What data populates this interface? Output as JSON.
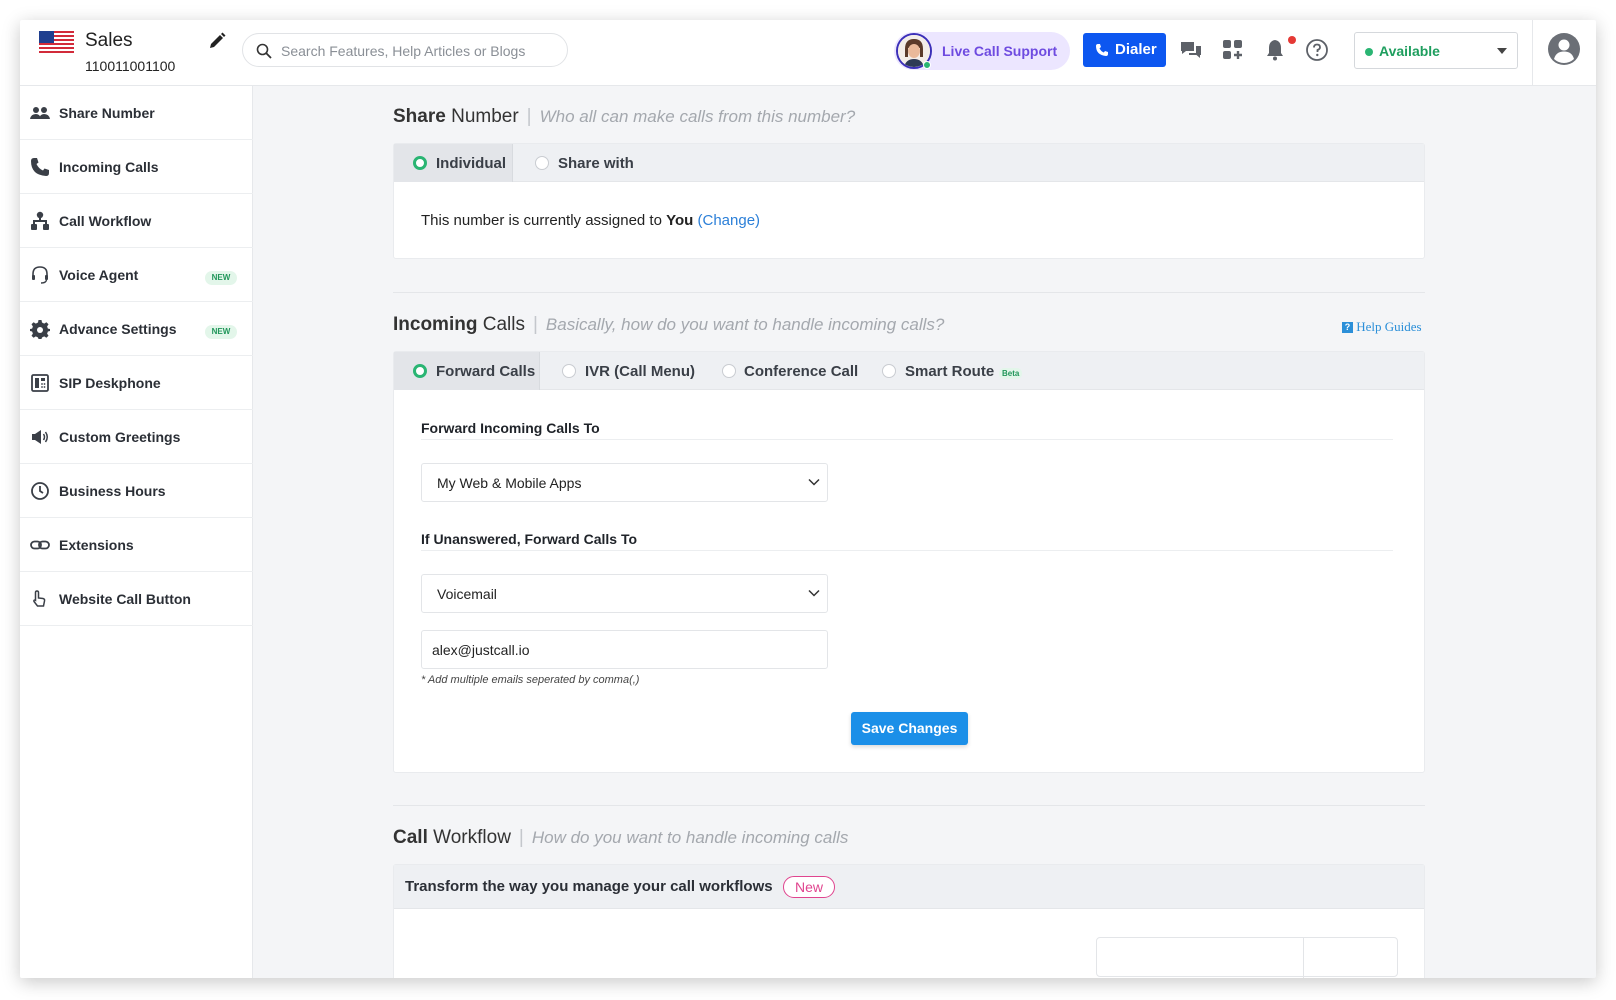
{
  "header": {
    "account_name": "Sales",
    "account_number": "110011001100",
    "search_placeholder": "Search Features, Help Articles or Blogs",
    "live_call_support_label": "Live Call Support",
    "dialer_label": "Dialer",
    "status_label": "Available",
    "colors": {
      "dialer": "#0d57f0",
      "live_support_bg": "#ece6ff",
      "status_green": "#1e9e5e"
    }
  },
  "sidebar": {
    "items": [
      {
        "label": "Share Number",
        "icon": "users-icon",
        "badge": ""
      },
      {
        "label": "Incoming Calls",
        "icon": "phone-icon",
        "badge": ""
      },
      {
        "label": "Call Workflow",
        "icon": "workflow-icon",
        "badge": ""
      },
      {
        "label": "Voice Agent",
        "icon": "headset-icon",
        "badge": "NEW"
      },
      {
        "label": "Advance Settings",
        "icon": "gear-icon",
        "badge": "NEW"
      },
      {
        "label": "SIP Deskphone",
        "icon": "deskphone-icon",
        "badge": ""
      },
      {
        "label": "Custom Greetings",
        "icon": "megaphone-icon",
        "badge": ""
      },
      {
        "label": "Business Hours",
        "icon": "clock-icon",
        "badge": ""
      },
      {
        "label": "Extensions",
        "icon": "link-icon",
        "badge": ""
      },
      {
        "label": "Website Call Button",
        "icon": "pointer-hand-icon",
        "badge": ""
      }
    ]
  },
  "share_number": {
    "title_bold": "Share",
    "title_rest": "Number",
    "subtitle": "Who all can make calls from this number?",
    "options": [
      "Individual",
      "Share with"
    ],
    "selected": "Individual",
    "assign_prefix": "This number is currently assigned to",
    "assign_user": "You",
    "change_link": "(Change)"
  },
  "incoming_calls": {
    "title_bold": "Incoming",
    "title_rest": "Calls",
    "subtitle": "Basically, how do you want to handle incoming calls?",
    "help_link": "Help Guides",
    "options": [
      "Forward Calls",
      "IVR (Call Menu)",
      "Conference Call",
      "Smart Route"
    ],
    "beta_badge": "Beta",
    "selected": "Forward Calls",
    "forward_label": "Forward Incoming Calls To",
    "forward_value": "My Web & Mobile Apps",
    "unanswered_label": "If Unanswered, Forward Calls To",
    "unanswered_value": "Voicemail",
    "email_value": "alex@justcall.io",
    "email_hint": "* Add multiple emails seperated by comma(,)",
    "save_label": "Save Changes"
  },
  "call_workflow": {
    "title_bold": "Call",
    "title_rest": "Workflow",
    "subtitle": "How do you want to handle incoming calls",
    "banner_text": "Transform the way you manage your call workflows",
    "new_badge": "New"
  }
}
